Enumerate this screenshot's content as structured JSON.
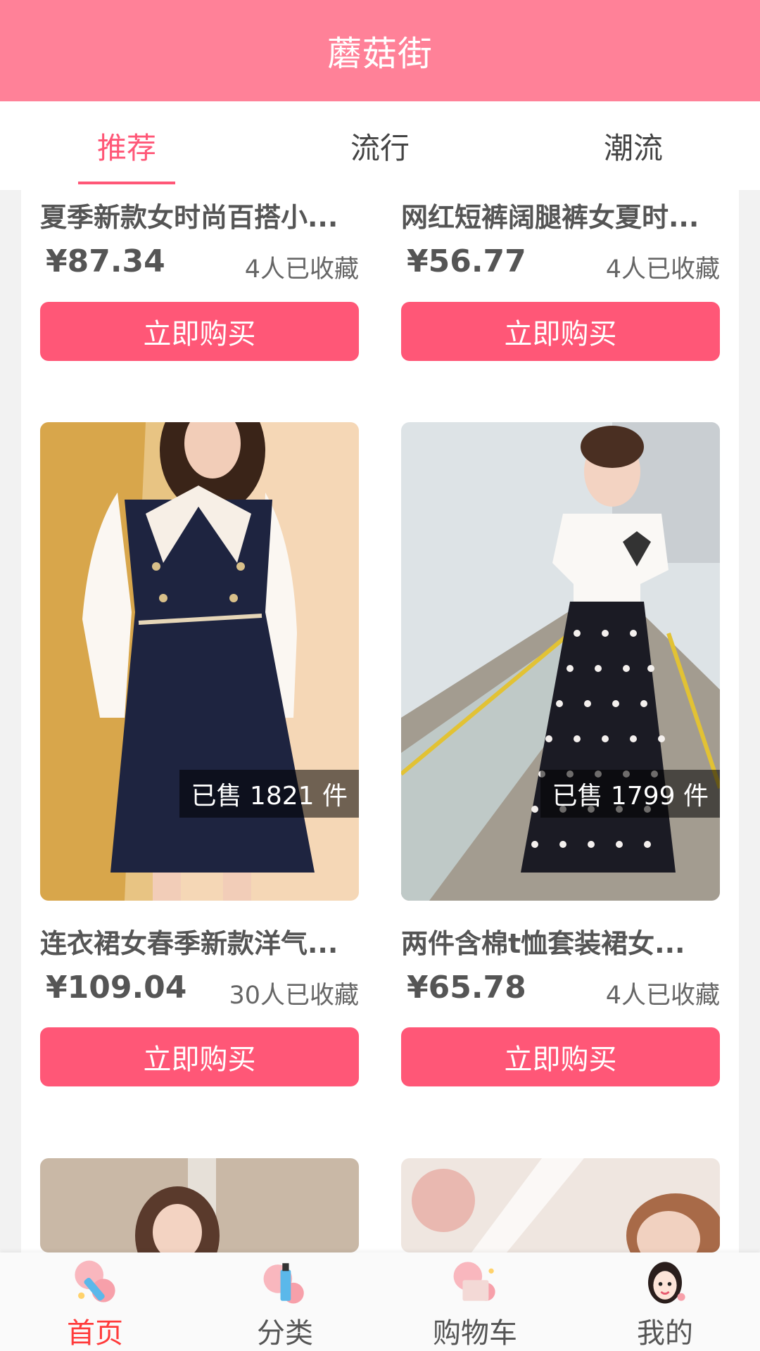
{
  "header": {
    "title": "蘑菇街"
  },
  "tabs": [
    {
      "label": "推荐",
      "active": true
    },
    {
      "label": "流行",
      "active": false
    },
    {
      "label": "潮流",
      "active": false
    }
  ],
  "products": [
    {
      "title": "夏季新款女时尚百搭小...",
      "price": "¥87.34",
      "favs": "4人已收藏",
      "buy_label": "立即购买"
    },
    {
      "title": "网红短裤阔腿裤女夏时...",
      "price": "¥56.77",
      "favs": "4人已收藏",
      "buy_label": "立即购买"
    },
    {
      "title": "连衣裙女春季新款洋气...",
      "price": "¥109.04",
      "favs": "30人已收藏",
      "sold": "已售 1821 件",
      "buy_label": "立即购买"
    },
    {
      "title": "两件含棉t恤套装裙女...",
      "price": "¥65.78",
      "favs": "4人已收藏",
      "sold": "已售 1799 件",
      "buy_label": "立即购买"
    }
  ],
  "bottom_nav": [
    {
      "label": "首页",
      "icon": "home-icon",
      "active": true
    },
    {
      "label": "分类",
      "icon": "category-icon",
      "active": false
    },
    {
      "label": "购物车",
      "icon": "cart-icon",
      "active": false
    },
    {
      "label": "我的",
      "icon": "profile-icon",
      "active": false
    }
  ],
  "colors": {
    "header_bg": "#ff8198",
    "accent": "#ff5777",
    "nav_active": "#ff3b3b"
  }
}
